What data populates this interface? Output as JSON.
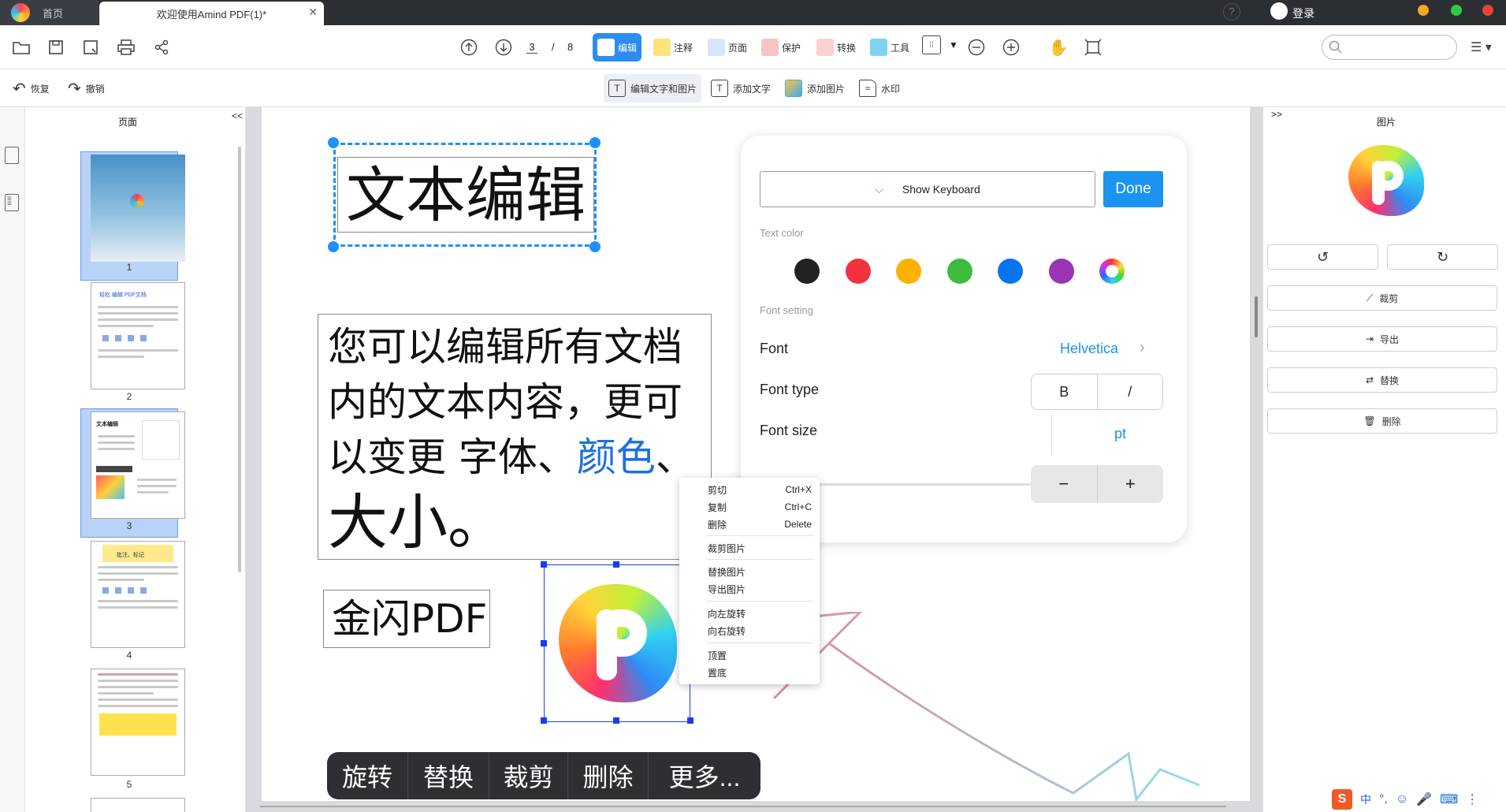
{
  "titlebar": {
    "home_tab": "首页",
    "doc_tab": "欢迎使用Amind PDF(1)*",
    "login": "登录",
    "colors": {
      "orange": "#f5a623",
      "green": "#2ecc40",
      "bg": "#2b2e33"
    }
  },
  "toolbar": {
    "current_page": "3",
    "separator": "/",
    "total_pages": "8",
    "modes": [
      {
        "label": "编辑",
        "icon": "edit-icon"
      },
      {
        "label": "注释",
        "icon": "comment-icon"
      },
      {
        "label": "页面",
        "icon": "page-icon"
      },
      {
        "label": "保护",
        "icon": "protect-icon"
      },
      {
        "label": "转换",
        "icon": "convert-icon"
      },
      {
        "label": "工具",
        "icon": "tools-icon"
      }
    ],
    "search_placeholder": "",
    "accent": "#2d8cf0"
  },
  "subbar": {
    "undo": "恢复",
    "redo": "撤销",
    "tools": [
      {
        "label": "编辑文字和图片",
        "icon": "edit-text-image-icon"
      },
      {
        "label": "添加文字",
        "icon": "add-text-icon"
      },
      {
        "label": "添加图片",
        "icon": "add-image-icon"
      },
      {
        "label": "水印",
        "icon": "watermark-icon"
      }
    ]
  },
  "thumbs": {
    "title": "页面",
    "collapse": "<<",
    "pages": [
      "1",
      "2",
      "3",
      "4",
      "5"
    ],
    "t2_heading": "轻松 编辑 PDF文档",
    "t3_heading": "文本编辑",
    "t4_heading": "批注、标记"
  },
  "page": {
    "heading": "文本编辑",
    "body_line1": "您可以编辑所有文档",
    "body_line2": "内的文本内容，更可",
    "body_line3a": "以变更 字体、",
    "body_line3b": "颜色",
    "body_line3c": "、",
    "body_line4": "大小。",
    "small_box": "金闪PDF",
    "highlight_color": "#1e6fe0"
  },
  "keyboard_panel": {
    "show_keyboard": "Show Keyboard",
    "done": "Done",
    "text_color_label": "Text color",
    "font_setting_label": "Font setting",
    "font_label": "Font",
    "font_value": "Helvetica",
    "font_type_label": "Font type",
    "bold": "B",
    "italic": "/",
    "font_size_label": "Font size",
    "unit": "pt",
    "minus": "−",
    "plus": "+",
    "swatches": [
      "#222222",
      "#f0333f",
      "#ffb000",
      "#3dbb3d",
      "#0a73f0",
      "#9b34b5"
    ]
  },
  "context_menu": {
    "cut": "剪切",
    "cut_key": "Ctrl+X",
    "copy": "复制",
    "copy_key": "Ctrl+C",
    "delete": "删除",
    "delete_key": "Delete",
    "crop": "裁剪图片",
    "replace": "替换图片",
    "export": "导出图片",
    "rotate_left": "向左旋转",
    "rotate_right": "向右旋转",
    "top": "顶置",
    "bottom": "置底"
  },
  "action_bar": {
    "items": [
      "旋转",
      "替换",
      "裁剪",
      "删除",
      "更多..."
    ]
  },
  "right_panel": {
    "expand": ">>",
    "title": "图片",
    "crop": "裁剪",
    "export": "导出",
    "replace": "替换",
    "delete": "删除"
  },
  "ime": {
    "label": "中"
  }
}
